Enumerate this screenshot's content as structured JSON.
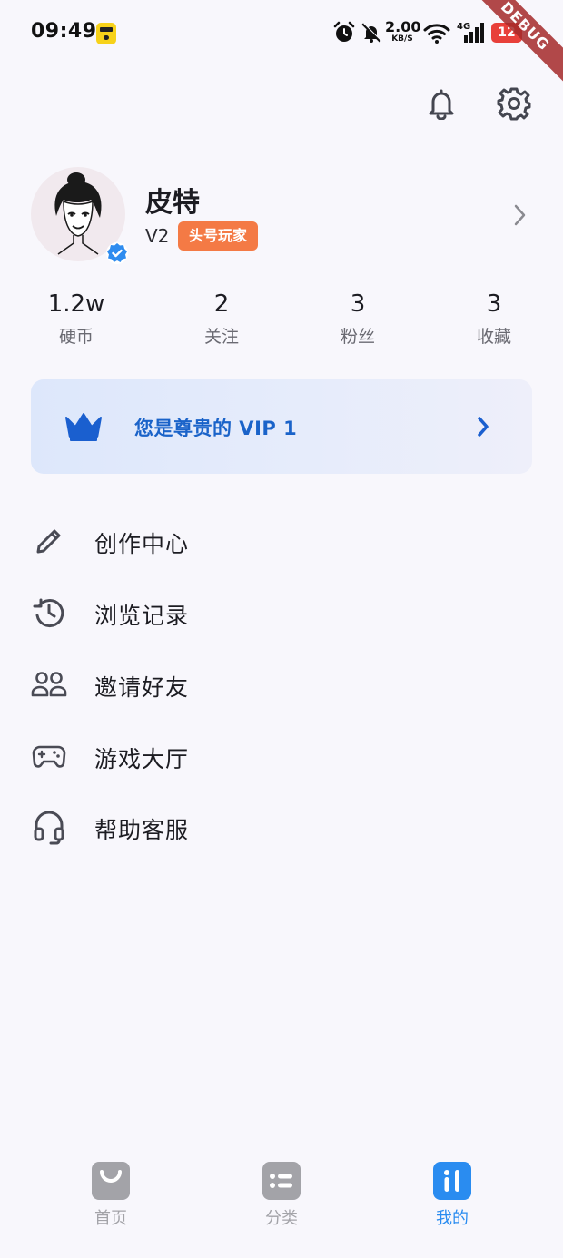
{
  "status_bar": {
    "time": "09:49",
    "net_speed_value": "2.00",
    "net_speed_unit": "KB/S",
    "network_type": "4G",
    "battery": "12",
    "debug_label": "DEBUG"
  },
  "header": {
    "icons": [
      "bell-icon",
      "gear-icon"
    ]
  },
  "profile": {
    "name": "皮特",
    "level": "V2",
    "tag": "头号玩家"
  },
  "stats": [
    {
      "value": "1.2w",
      "label": "硬币"
    },
    {
      "value": "2",
      "label": "关注"
    },
    {
      "value": "3",
      "label": "粉丝"
    },
    {
      "value": "3",
      "label": "收藏"
    }
  ],
  "vip": {
    "text": "您是尊贵的 VIP 1"
  },
  "menu": [
    {
      "label": "创作中心",
      "icon": "pencil-icon"
    },
    {
      "label": "浏览记录",
      "icon": "history-icon"
    },
    {
      "label": "邀请好友",
      "icon": "people-icon"
    },
    {
      "label": "游戏大厅",
      "icon": "gamepad-icon"
    },
    {
      "label": "帮助客服",
      "icon": "headset-icon"
    }
  ],
  "bottom_nav": [
    {
      "label": "首页",
      "icon": "shop-bag-icon",
      "active": false
    },
    {
      "label": "分类",
      "icon": "list-icon",
      "active": false
    },
    {
      "label": "我的",
      "icon": "profile-tab-icon",
      "active": true
    }
  ],
  "colors": {
    "background": "#f8f7fc",
    "accent_blue": "#1a63c9",
    "tab_active": "#2a8cf0",
    "tab_inactive": "#a3a3a8",
    "tag_orange": "#f47a45"
  }
}
